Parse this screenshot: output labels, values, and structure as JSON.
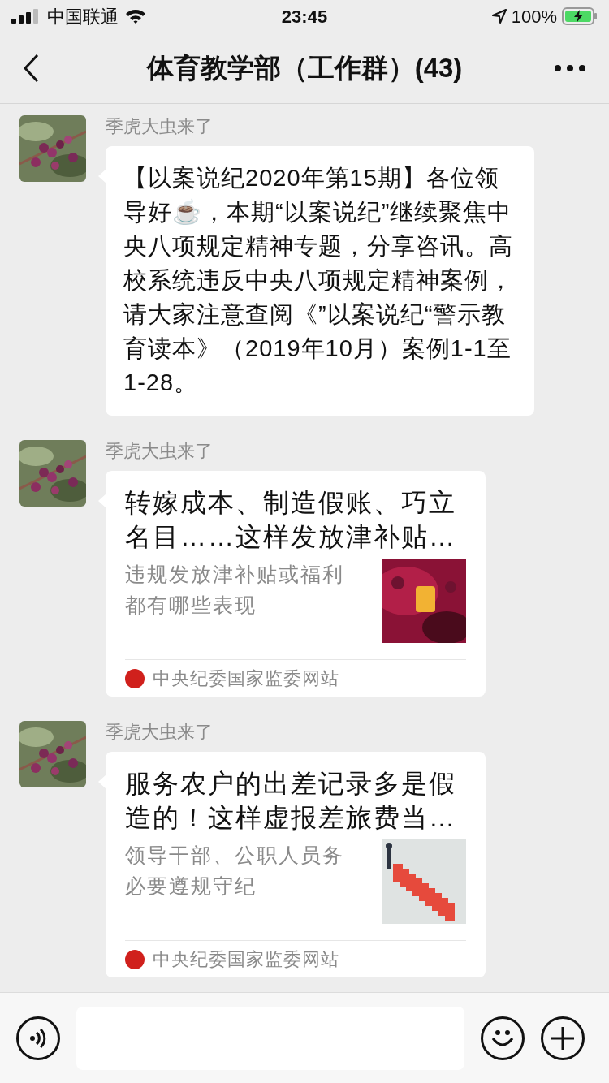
{
  "status_bar": {
    "carrier": "中国联通",
    "time": "23:45",
    "battery": "100%"
  },
  "header": {
    "title": "体育教学部（工作群）(43)"
  },
  "messages": [
    {
      "kind": "text",
      "sender": "季虎大虫来了",
      "text": "【以案说纪2020年第15期】各位领导好☕，本期“以案说纪”继续聚焦中央八项规定精神专题，分享咨讯。高校系统违反中央八项规定精神案例，请大家注意查阅《”以案说纪“警示教育读本》（2019年10月）案例1-1至1-28。"
    },
    {
      "kind": "link",
      "sender": "季虎大虫来了",
      "title": "转嫁成本、制造假账、巧立名目……这样发放津补贴…",
      "description": "违规发放津补贴或福利都有哪些表现",
      "source": "中央纪委国家监委网站"
    },
    {
      "kind": "link",
      "sender": "季虎大虫来了",
      "title": "服务农户的出差记录多是假造的！这样虚报差旅费当…",
      "description": "领导干部、公职人员务必要遵规守纪",
      "source": "中央纪委国家监委网站"
    }
  ]
}
